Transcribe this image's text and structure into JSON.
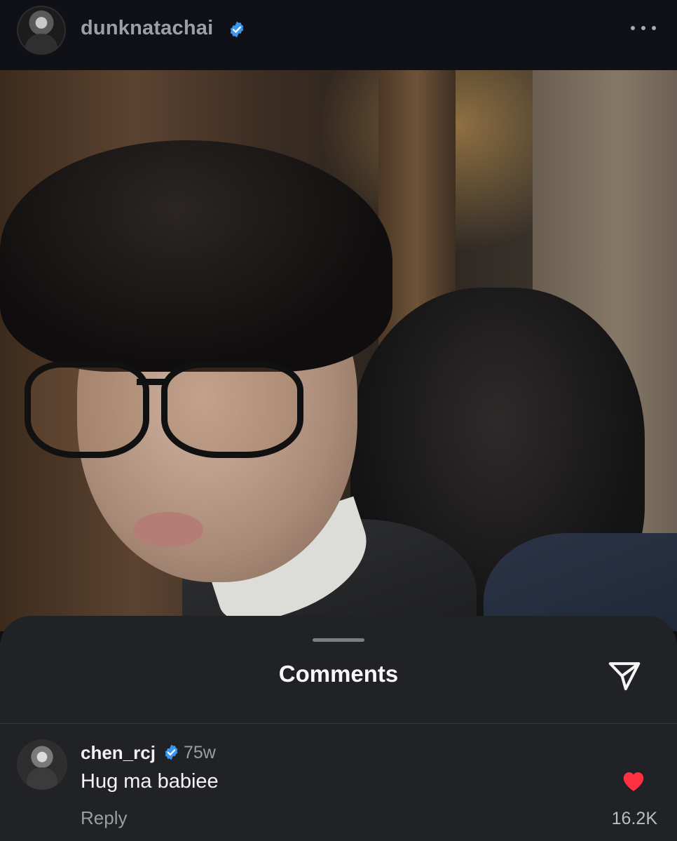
{
  "post": {
    "username": "dunknatachai",
    "verified": true,
    "more_icon": "more-horizontal-icon"
  },
  "comments_sheet": {
    "title": "Comments",
    "share_icon": "send-paper-plane-icon",
    "comments": [
      {
        "username": "chen_rcj",
        "verified": true,
        "time_ago": "75w",
        "text": "Hug ma babiee",
        "reply_label": "Reply",
        "liked": true,
        "like_count": "16.2K"
      }
    ]
  },
  "colors": {
    "verified_blue": "#3897f0",
    "heart_red": "#ff3040",
    "sheet_bg": "#212226",
    "header_bg": "#0f1116"
  }
}
